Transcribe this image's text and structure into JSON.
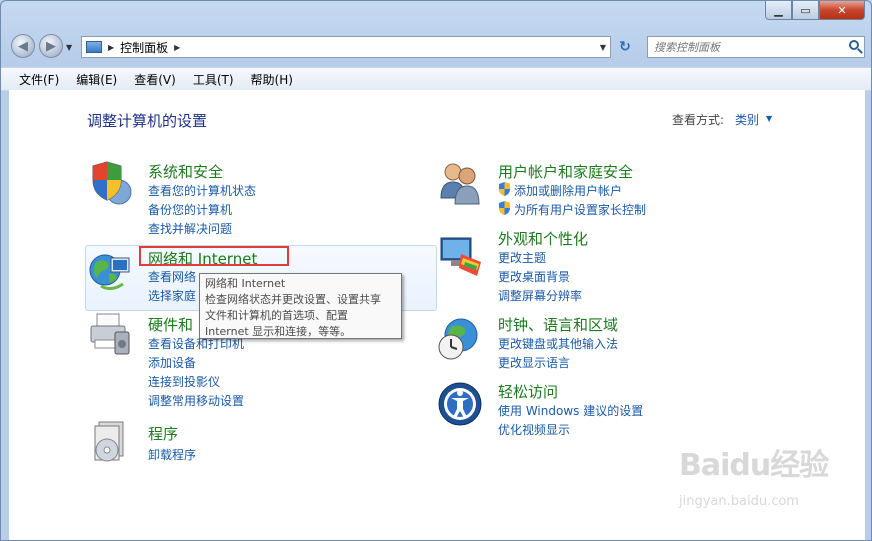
{
  "window": {
    "caption_min": "▁",
    "caption_max": "▭",
    "caption_close": "✕"
  },
  "nav": {
    "back_icon": "arrow-left-icon",
    "forward_icon": "arrow-right-icon"
  },
  "address": {
    "path": "控制面板"
  },
  "search": {
    "placeholder": "搜索控制面板"
  },
  "menu": [
    "文件(F)",
    "编辑(E)",
    "查看(V)",
    "工具(T)",
    "帮助(H)"
  ],
  "page_title": "调整计算机的设置",
  "view_by": {
    "label": "查看方式:",
    "value": "类别"
  },
  "categories": {
    "system": {
      "title": "系统和安全",
      "links": [
        "查看您的计算机状态",
        "备份您的计算机",
        "查找并解决问题"
      ]
    },
    "network": {
      "title": "网络和 Internet",
      "links": [
        "查看网络",
        "选择家庭"
      ]
    },
    "hardware": {
      "title": "硬件和",
      "links": [
        "查看设备和打印机",
        "添加设备",
        "连接到投影仪",
        "调整常用移动设置"
      ]
    },
    "programs": {
      "title": "程序",
      "links": [
        "卸载程序"
      ]
    },
    "users": {
      "title": "用户帐户和家庭安全",
      "links": [
        "添加或删除用户帐户",
        "为所有用户设置家长控制"
      ]
    },
    "appearance": {
      "title": "外观和个性化",
      "links": [
        "更改主题",
        "更改桌面背景",
        "调整屏幕分辨率"
      ]
    },
    "clock": {
      "title": "时钟、语言和区域",
      "links": [
        "更改键盘或其他输入法",
        "更改显示语言"
      ]
    },
    "ease": {
      "title": "轻松访问",
      "links": [
        "使用 Windows 建议的设置",
        "优化视频显示"
      ]
    }
  },
  "tooltip": {
    "lines": [
      "网络和 Internet",
      "检查网络状态并更改设置、设置共享",
      "文件和计算机的首选项、配置",
      "Internet 显示和连接，等等。"
    ]
  },
  "watermark": {
    "brand": "Baidu经验",
    "url": "jingyan.baidu.com"
  }
}
